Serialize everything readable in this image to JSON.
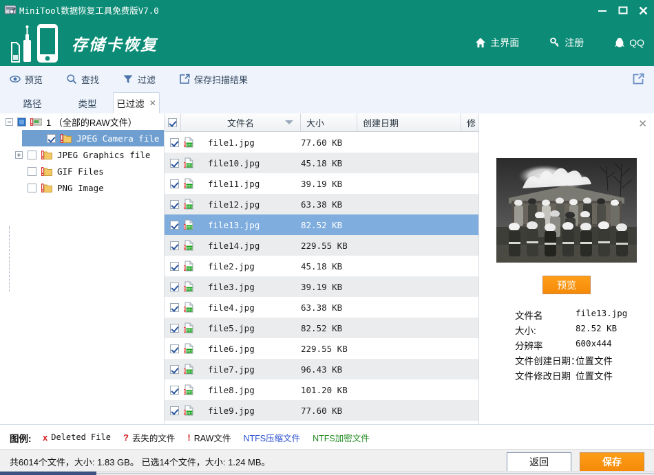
{
  "window": {
    "title": "MiniTool数据恢复工具免费版V7.0",
    "app_icon": "app-icon",
    "minimize": "minimize-icon",
    "maximize": "maximize-icon",
    "close": "close-icon",
    "theme_color": "#0c8c76"
  },
  "banner": {
    "product_title": "存储卡恢复",
    "art": "phone-usb-sdcard-icon",
    "nav": [
      {
        "label": "主界面",
        "icon": "home-icon"
      },
      {
        "label": "注册",
        "icon": "key-icon"
      },
      {
        "label": "QQ",
        "icon": "qq-penguin-icon"
      }
    ]
  },
  "toolbar": {
    "items": [
      {
        "label": "预览",
        "icon": "eye-icon"
      },
      {
        "label": "查找",
        "icon": "search-icon"
      },
      {
        "label": "过滤",
        "icon": "funnel-icon"
      },
      {
        "label": "保存扫描结果",
        "icon": "export-icon"
      }
    ],
    "right_icon": "share-export-icon"
  },
  "tabs": [
    {
      "label": "路径",
      "active": false,
      "closable": false
    },
    {
      "label": "类型",
      "active": false,
      "closable": false
    },
    {
      "label": "已过滤",
      "active": true,
      "closable": true,
      "close_glyph": "✕"
    }
  ],
  "tree": {
    "root": {
      "label": "1  （全部的RAW文件）",
      "expanded": true,
      "icon": "raw-drive-icon",
      "checkbox": "partial"
    },
    "children": [
      {
        "label": "JPEG Camera file",
        "checked": true,
        "selected": true,
        "expandable": false,
        "icon": "folder-warning-icon"
      },
      {
        "label": "JPEG Graphics file",
        "checked": false,
        "selected": false,
        "expandable": true,
        "icon": "folder-warning-icon"
      },
      {
        "label": "GIF Files",
        "checked": false,
        "selected": false,
        "expandable": false,
        "icon": "folder-warning-icon"
      },
      {
        "label": "PNG Image",
        "checked": false,
        "selected": false,
        "expandable": false,
        "icon": "folder-warning-icon"
      }
    ]
  },
  "filelist": {
    "header_checkbox": "checked",
    "columns": [
      {
        "key": "name",
        "label": "文件名",
        "sorted": true,
        "sort_dir": "desc"
      },
      {
        "key": "size",
        "label": "大小"
      },
      {
        "key": "created",
        "label": "创建日期"
      },
      {
        "key": "modified",
        "label": "修改日期",
        "truncated_label": "修"
      }
    ],
    "rows": [
      {
        "name": "file1.jpg",
        "size": "77.60 KB",
        "checked": true,
        "selected": false
      },
      {
        "name": "file10.jpg",
        "size": "45.18 KB",
        "checked": true,
        "selected": false
      },
      {
        "name": "file11.jpg",
        "size": "39.19 KB",
        "checked": true,
        "selected": false
      },
      {
        "name": "file12.jpg",
        "size": "63.38 KB",
        "checked": true,
        "selected": false
      },
      {
        "name": "file13.jpg",
        "size": "82.52 KB",
        "checked": true,
        "selected": true
      },
      {
        "name": "file14.jpg",
        "size": "229.55 KB",
        "checked": true,
        "selected": false
      },
      {
        "name": "file2.jpg",
        "size": "45.18 KB",
        "checked": true,
        "selected": false
      },
      {
        "name": "file3.jpg",
        "size": "39.19 KB",
        "checked": true,
        "selected": false
      },
      {
        "name": "file4.jpg",
        "size": "63.38 KB",
        "checked": true,
        "selected": false
      },
      {
        "name": "file5.jpg",
        "size": "82.52 KB",
        "checked": true,
        "selected": false
      },
      {
        "name": "file6.jpg",
        "size": "229.55 KB",
        "checked": true,
        "selected": false
      },
      {
        "name": "file7.jpg",
        "size": "96.43 KB",
        "checked": true,
        "selected": false
      },
      {
        "name": "file8.jpg",
        "size": "101.20 KB",
        "checked": true,
        "selected": false
      },
      {
        "name": "file9.jpg",
        "size": "77.60 KB",
        "checked": true,
        "selected": false
      }
    ]
  },
  "preview": {
    "close_glyph": "✕",
    "image_alt": "firefighters-group-photo-burning-house",
    "button_label": "预览",
    "meta": [
      {
        "key": "文件名",
        "value": "file13.jpg",
        "mono": true
      },
      {
        "key": "大小:",
        "value": "82.52 KB",
        "mono": true
      },
      {
        "key": "分辨率",
        "value": "600x444",
        "mono": true
      },
      {
        "key": "文件创建日期：",
        "value": "位置文件",
        "mono": false
      },
      {
        "key": "文件修改日期",
        "value": "位置文件",
        "mono": false
      }
    ]
  },
  "legend": {
    "title": "图例:",
    "items": [
      {
        "mark": "x",
        "label": "Deleted File",
        "mark_color": "#d42020",
        "label_color": "#111111",
        "mono": true
      },
      {
        "mark": "?",
        "label": "丢失的文件",
        "mark_color": "#d42020",
        "label_color": "#111111",
        "mono": false
      },
      {
        "mark": "!",
        "label": "RAW文件",
        "mark_color": "#d42020",
        "label_color": "#111111",
        "mono": false
      },
      {
        "mark": "",
        "label": "NTFS压缩文件",
        "mark_color": "",
        "label_color": "#2a4fd4",
        "mono": false
      },
      {
        "mark": "",
        "label": "NTFS加密文件",
        "mark_color": "",
        "label_color": "#1f8a1f",
        "mono": false
      }
    ]
  },
  "status": {
    "text": "共6014个文件，大小: 1.83 GB。 已选14个文件，大小: 1.24 MB。",
    "total_files": "6014",
    "total_size": "1.83 GB",
    "selected_files": "14",
    "selected_size": "1.24 MB",
    "back_button": "返回",
    "save_button": "保存"
  }
}
